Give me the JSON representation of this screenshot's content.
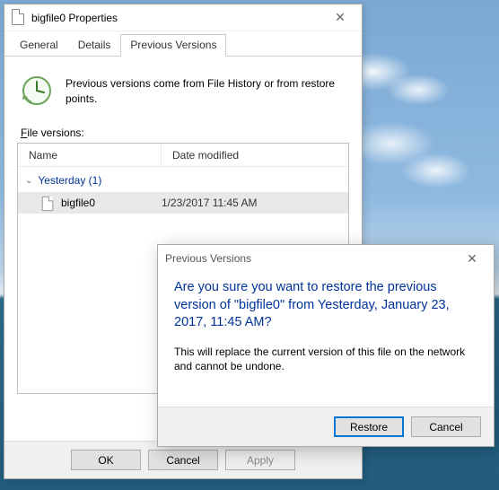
{
  "props": {
    "title": "bigfile0 Properties",
    "tabs": {
      "general": "General",
      "details": "Details",
      "previous": "Previous Versions"
    },
    "intro": "Previous versions come from File History or from restore points.",
    "list_label": "File versions:",
    "columns": {
      "name": "Name",
      "date": "Date modified"
    },
    "group": "Yesterday (1)",
    "file": {
      "name": "bigfile0",
      "date": "1/23/2017 11:45 AM"
    },
    "buttons": {
      "ok": "OK",
      "cancel": "Cancel",
      "apply": "Apply"
    }
  },
  "confirm": {
    "title": "Previous Versions",
    "main": "Are you sure you want to restore the previous version of \"bigfile0\" from Yesterday, January 23, 2017, 11:45 AM?",
    "sub": "This will replace the current version of this file on the network and cannot be undone.",
    "buttons": {
      "restore": "Restore",
      "cancel": "Cancel"
    }
  }
}
